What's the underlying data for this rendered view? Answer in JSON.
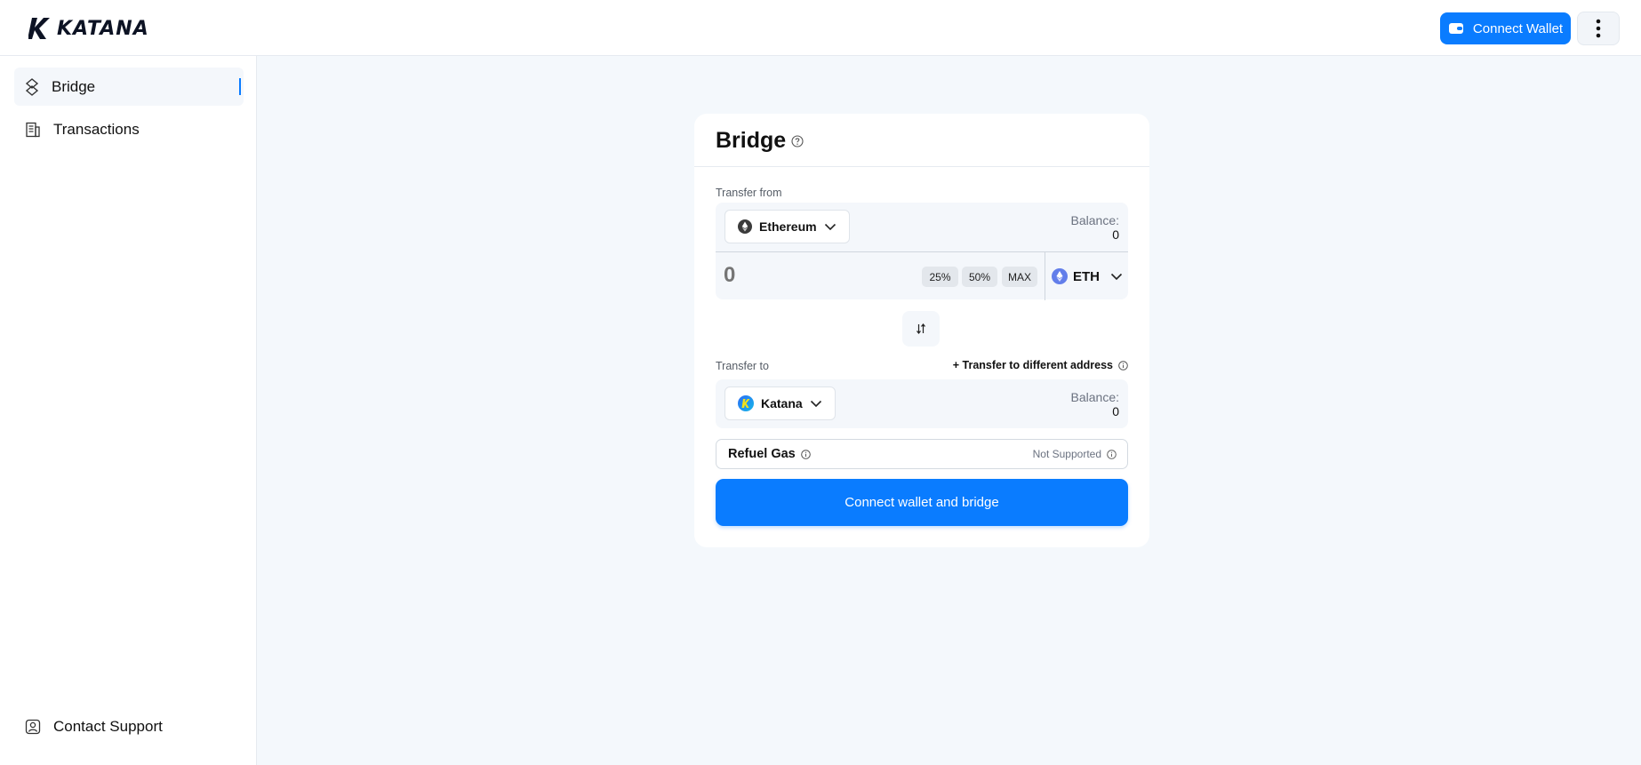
{
  "header": {
    "logo_text": "KATANA",
    "connect_wallet_label": "Connect Wallet"
  },
  "sidebar": {
    "items": [
      {
        "label": "Bridge",
        "icon": "bridge-icon",
        "active": true
      },
      {
        "label": "Transactions",
        "icon": "receipt-icon",
        "active": false
      }
    ],
    "support_label": "Contact Support"
  },
  "bridge": {
    "title": "Bridge",
    "transfer_from_label": "Transfer from",
    "from_chain": "Ethereum",
    "from_balance_label": "Balance:",
    "from_balance_value": "0",
    "amount_placeholder": "0",
    "pct_25": "25%",
    "pct_50": "50%",
    "pct_max": "MAX",
    "token": "ETH",
    "transfer_to_label": "Transfer to",
    "different_address_label": "+ Transfer to different address",
    "to_chain": "Katana",
    "to_balance_label": "Balance:",
    "to_balance_value": "0",
    "refuel_label": "Refuel Gas",
    "refuel_status": "Not Supported",
    "submit_label": "Connect wallet and bridge"
  },
  "colors": {
    "accent": "#0a7cff",
    "background": "#f4f8fc",
    "eth_icon": "#627eea"
  }
}
